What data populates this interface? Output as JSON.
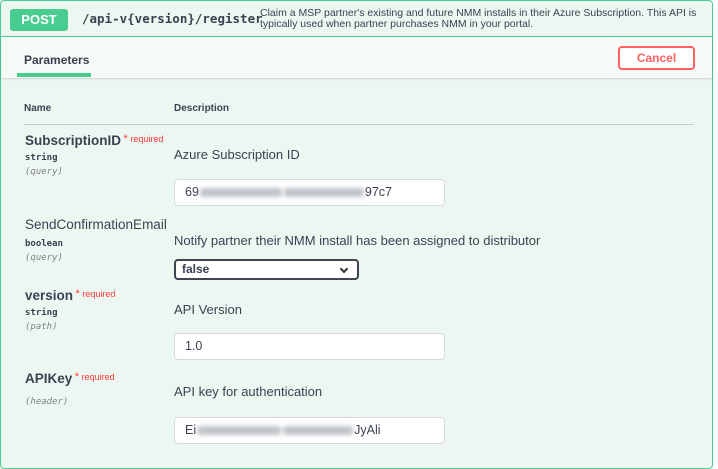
{
  "operation": {
    "method": "POST",
    "path": "/api-v{version}/register",
    "description": "Claim a MSP partner's existing and future NMM installs in their Azure Subscription. This API is typically used when partner purchases NMM in your portal."
  },
  "section": {
    "tab_label": "Parameters",
    "cancel_label": "Cancel"
  },
  "table": {
    "col_name": "Name",
    "col_description": "Description"
  },
  "required_label": "required",
  "required_star": "*",
  "parameters": [
    {
      "name": "SubscriptionID",
      "required": true,
      "type": "string",
      "in": "(query)",
      "description": "Azure Subscription ID",
      "value_start": "69",
      "value_end": "97c7"
    },
    {
      "name": "SendConfirmationEmail",
      "required": false,
      "type": "boolean",
      "in": "(query)",
      "description": "Notify partner their NMM install has been assigned to distributor",
      "value": "false"
    },
    {
      "name": "version",
      "required": true,
      "type": "string",
      "in": "(path)",
      "description": "API Version",
      "value": "1.0"
    },
    {
      "name": "APIKey",
      "required": true,
      "in": "(header)",
      "description": "API key for authentication",
      "value_start": "Ei",
      "value_end": "JyAli"
    }
  ],
  "colors": {
    "post_green": "#49cc90",
    "cancel_red": "#ff6060",
    "required_red": "#ff3939"
  }
}
